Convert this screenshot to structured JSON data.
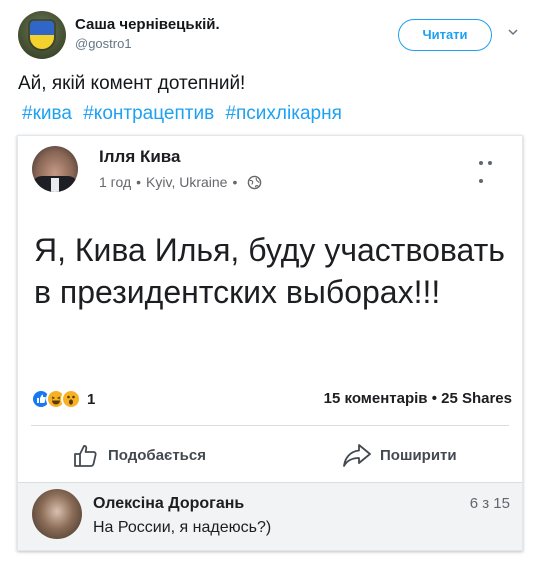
{
  "tweet": {
    "author_name": "Саша чернівецькій.",
    "author_handle": "@gostro1",
    "follow_label": "Читати",
    "text": "Ай, якій комент дотепний!",
    "hashtags": [
      "#кива",
      "#контрацептив",
      "#психлікарня"
    ]
  },
  "embedded_post": {
    "author": "Ілля Кива",
    "time": "1 год",
    "location": "Kyiv, Ukraine",
    "separator": "•",
    "body": "Я, Кива Илья, буду участвовать в президентских выборах!!!",
    "reaction_count": "1",
    "comments_shares": "15 коментарів • 25 Shares",
    "like_label": "Подобається",
    "share_label": "Поширити",
    "comment": {
      "author": "Олексіна Дорогань",
      "time": "6 з 15",
      "text": "На России, я надеюсь?)"
    }
  },
  "colors": {
    "twitter_blue": "#1da1f2",
    "facebook_blue": "#1877f2",
    "reaction_yellow": "#f7b125"
  }
}
